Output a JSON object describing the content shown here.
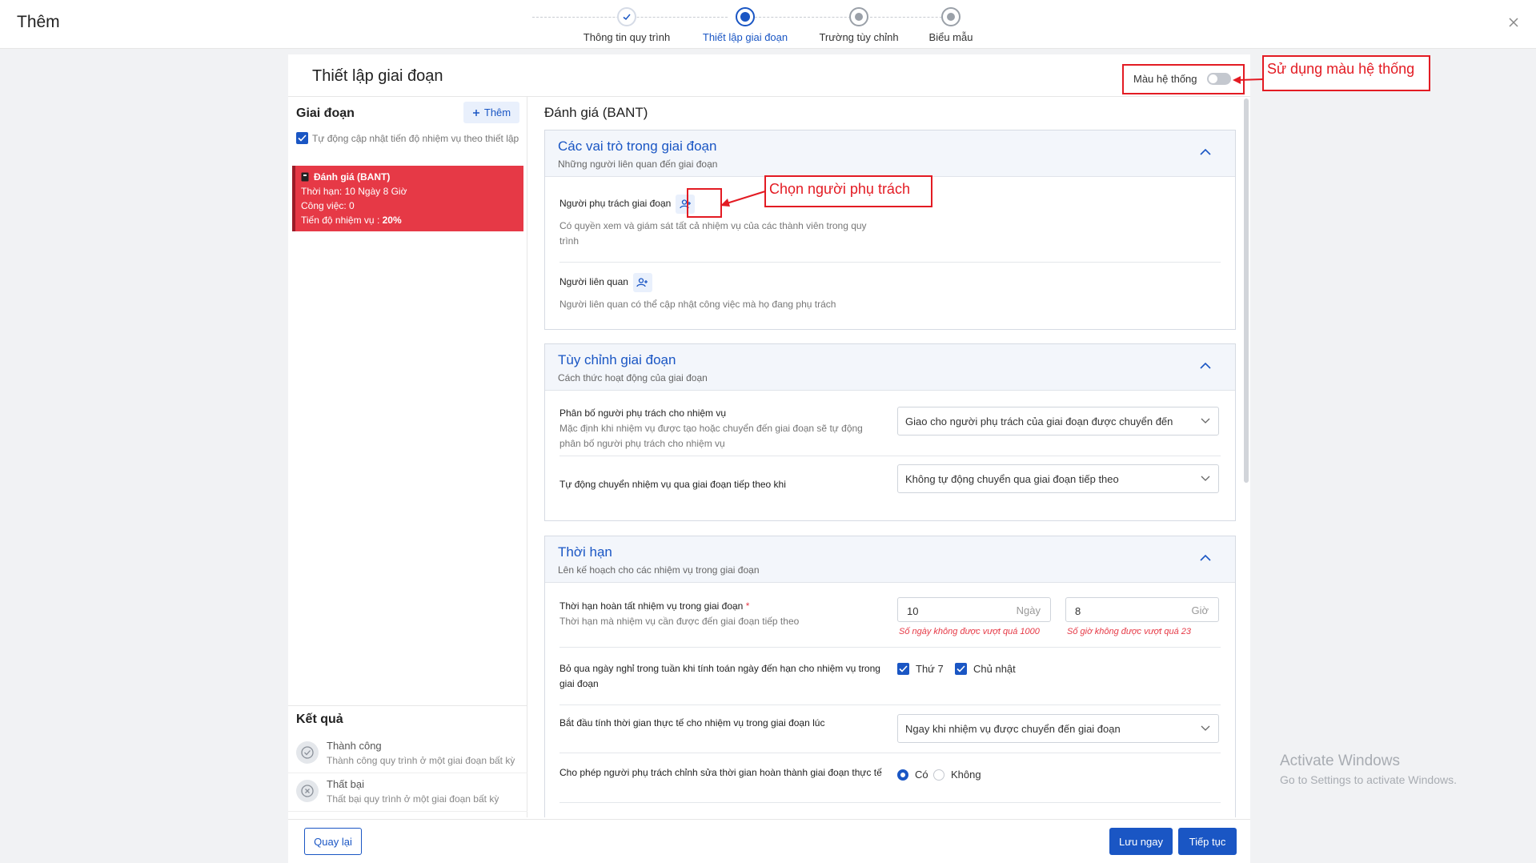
{
  "dialog": {
    "title": "Thêm"
  },
  "steps": [
    {
      "label": "Thông tin quy trình",
      "state": "done"
    },
    {
      "label": "Thiết lập giai đoạn",
      "state": "active"
    },
    {
      "label": "Trường tùy chỉnh",
      "state": "todo"
    },
    {
      "label": "Biểu mẫu",
      "state": "todo"
    }
  ],
  "panel": {
    "title": "Thiết lập giai đoạn",
    "system_color_label": "Màu hệ thống",
    "system_color_on": false
  },
  "callouts": {
    "system_color": "Sử dụng màu hệ thống",
    "choose_owner": "Chọn người phụ trách"
  },
  "stages": {
    "title": "Giai đoạn",
    "add_label": "Thêm",
    "auto_update_label": "Tự động cập nhật tiến độ nhiệm vụ theo thiết lập",
    "items": [
      {
        "name": "Đánh giá (BANT)",
        "duration": "Thời hạn: 10 Ngày 8 Giờ",
        "tasks": "Công việc: 0",
        "progress_label": "Tiến độ nhiệm vụ :",
        "progress": "20%"
      }
    ]
  },
  "results": {
    "title": "Kết quả",
    "items": [
      {
        "name": "Thành công",
        "desc": "Thành công quy trình ở một giai đoạn bất kỳ",
        "icon": "check-circle-icon"
      },
      {
        "name": "Thất bại",
        "desc": "Thất bại quy trình ở một giai đoạn bất kỳ",
        "icon": "x-circle-icon"
      }
    ]
  },
  "detail": {
    "stage_name": "Đánh giá (BANT)",
    "roles": {
      "title": "Các vai trò trong giai đoạn",
      "subtitle": "Những người liên quan đến giai đoạn",
      "owner_label": "Người phụ trách giai đoạn",
      "owner_desc": "Có quyền xem và giám sát tất cả nhiệm vụ của các thành viên trong quy trình",
      "related_label": "Người liên quan",
      "related_desc": "Người liên quan có thể cập nhật công việc mà họ đang phụ trách"
    },
    "custom": {
      "title": "Tùy chỉnh giai đoạn",
      "subtitle": "Cách thức hoạt động của giai đoạn",
      "assign_label": "Phân bố người phụ trách cho nhiệm vụ",
      "assign_desc": "Mặc định khi nhiệm vụ được tạo hoặc chuyển đến giai đoạn sẽ tự động phân bố người phụ trách cho nhiệm vụ",
      "assign_value": "Giao cho người phụ trách của giai đoạn được chuyển đến",
      "auto_move_label": "Tự động chuyển nhiệm vụ qua giai đoạn tiếp theo khi",
      "auto_move_value": "Không tự động chuyển qua giai đoạn tiếp theo"
    },
    "deadline": {
      "title": "Thời hạn",
      "subtitle": "Lên kế hoạch cho các nhiệm vụ trong giai đoạn",
      "complete_label": "Thời hạn hoàn tất nhiệm vụ trong giai đoạn",
      "required_mark": "*",
      "complete_desc": "Thời hạn mà nhiệm vụ cần được đến giai đoạn tiếp theo",
      "days_value": "10",
      "days_unit": "Ngày",
      "days_error": "Số ngày không được vượt quá 1000",
      "hours_value": "8",
      "hours_unit": "Giờ",
      "hours_error": "Số giờ không được vượt quá 23",
      "skip_label": "Bỏ qua ngày nghỉ trong tuần khi tính toán ngày đến hạn cho nhiệm vụ trong giai đoạn",
      "sat_label": "Thứ 7",
      "sun_label": "Chủ nhật",
      "start_label": "Bắt đầu tính thời gian thực tế cho nhiệm vụ trong giai đoạn lúc",
      "start_value": "Ngay khi nhiệm vụ được chuyển đến giai đoạn",
      "allow_label": "Cho phép người phụ trách chỉnh sửa thời gian hoàn thành giai đoạn thực tế",
      "yes_label": "Có",
      "no_label": "Không"
    }
  },
  "footer": {
    "back": "Quay lại",
    "save": "Lưu ngay",
    "next": "Tiếp tục"
  },
  "watermark": {
    "line1": "Activate Windows",
    "line2": "Go to Settings to activate Windows."
  },
  "colors": {
    "primary": "#1a56c4",
    "stage": "#e63946",
    "annotation": "#e31b23"
  }
}
